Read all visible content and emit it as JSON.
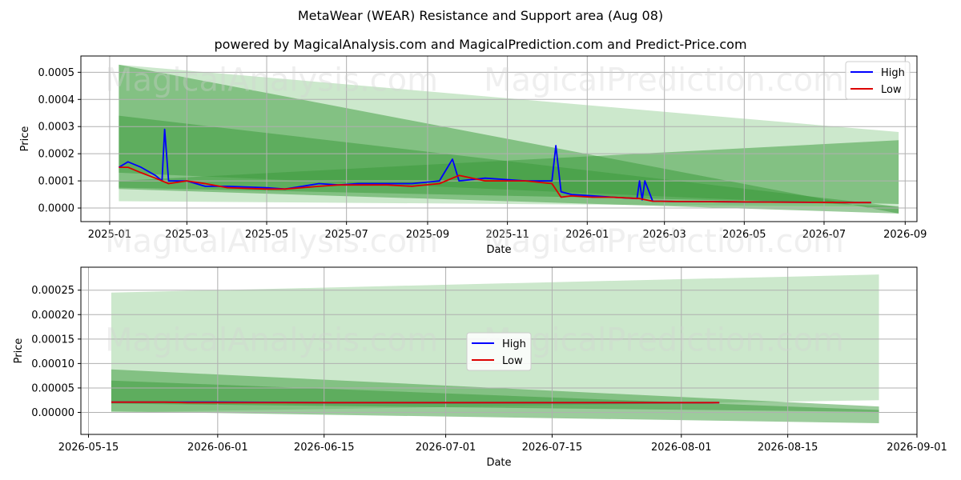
{
  "title": "MetaWear (WEAR) Resistance and Support area (Aug 08)",
  "subtitle": "powered by MagicalAnalysis.com and MagicalPrediction.com and Predict-Price.com",
  "watermark": [
    "MagicalAnalysis.com",
    "MagicalPrediction.com"
  ],
  "colors": {
    "high": "#0000ff",
    "low": "#dd0000",
    "band_dark": "#3a9a3a",
    "band_light": "#8fcc8f"
  },
  "chart_data": [
    {
      "type": "line",
      "xlabel": "Date",
      "ylabel": "Price",
      "x_ticks": [
        "2025-01",
        "2025-03",
        "2025-05",
        "2025-07",
        "2025-09",
        "2025-11",
        "2026-01",
        "2026-03",
        "2026-05",
        "2026-07",
        "2026-09"
      ],
      "y_ticks": [
        "0.0000",
        "0.0001",
        "0.0002",
        "0.0003",
        "0.0004",
        "0.0005"
      ],
      "xlim": [
        "2024-12-10",
        "2026-09-10"
      ],
      "ylim": [
        -5e-05,
        0.00056
      ],
      "grid": true,
      "legend": {
        "position": "top-right",
        "entries": [
          "High",
          "Low"
        ]
      },
      "series": [
        {
          "name": "High",
          "x": [
            "2025-01-08",
            "2025-01-15",
            "2025-01-25",
            "2025-02-05",
            "2025-02-10",
            "2025-02-12",
            "2025-02-15",
            "2025-03-01",
            "2025-03-15",
            "2025-04-01",
            "2025-05-01",
            "2025-05-15",
            "2025-06-10",
            "2025-06-25",
            "2025-07-10",
            "2025-08-01",
            "2025-08-20",
            "2025-09-10",
            "2025-09-20",
            "2025-09-25",
            "2025-10-15",
            "2025-11-15",
            "2025-12-05",
            "2025-12-08",
            "2025-12-12",
            "2025-12-20",
            "2026-01-05",
            "2026-01-20",
            "2026-02-08",
            "2026-02-10",
            "2026-02-12",
            "2026-02-14",
            "2026-02-20",
            "2026-03-10",
            "2026-04-15",
            "2026-05-20",
            "2026-06-20",
            "2026-07-20",
            "2026-08-06"
          ],
          "values": [
            0.00015,
            0.00017,
            0.00015,
            0.00012,
            0.0001,
            0.00029,
            0.0001,
            0.0001,
            8e-05,
            8e-05,
            7.5e-05,
            7e-05,
            9e-05,
            8.5e-05,
            9e-05,
            9e-05,
            9e-05,
            0.0001,
            0.00018,
            0.0001,
            0.00011,
            0.0001,
            0.0001,
            0.00023,
            6e-05,
            5e-05,
            4.5e-05,
            4e-05,
            3.5e-05,
            0.0001,
            3e-05,
            0.0001,
            2.5e-05,
            2.4e-05,
            2.3e-05,
            2.2e-05,
            2.1e-05,
            2e-05,
            2e-05
          ]
        },
        {
          "name": "Low",
          "x": [
            "2025-01-08",
            "2025-01-15",
            "2025-01-25",
            "2025-02-05",
            "2025-02-15",
            "2025-03-01",
            "2025-03-15",
            "2025-04-01",
            "2025-05-01",
            "2025-05-15",
            "2025-06-10",
            "2025-06-25",
            "2025-07-10",
            "2025-08-01",
            "2025-08-20",
            "2025-09-10",
            "2025-09-25",
            "2025-10-15",
            "2025-11-15",
            "2025-12-05",
            "2025-12-12",
            "2025-12-20",
            "2026-01-05",
            "2026-01-20",
            "2026-02-10",
            "2026-02-20",
            "2026-03-10",
            "2026-04-15",
            "2026-05-20",
            "2026-06-20",
            "2026-07-20",
            "2026-08-06"
          ],
          "values": [
            0.00015,
            0.00015,
            0.00013,
            0.00011,
            9e-05,
            0.0001,
            9e-05,
            7.5e-05,
            7e-05,
            7e-05,
            8e-05,
            8.5e-05,
            8.5e-05,
            8.5e-05,
            8e-05,
            9e-05,
            0.00012,
            0.0001,
            0.0001,
            9e-05,
            4e-05,
            4.5e-05,
            4e-05,
            4e-05,
            3.5e-05,
            2.5e-05,
            2.4e-05,
            2.3e-05,
            2.2e-05,
            2.1e-05,
            2e-05,
            2e-05
          ]
        }
      ],
      "bands": [
        {
          "shade": "light",
          "x": [
            "2025-01-08",
            "2026-08-27"
          ],
          "upper": [
            0.000528,
            0.00028
          ],
          "lower": [
            2.5e-05,
            5e-06
          ]
        },
        {
          "shade": "mid",
          "x": [
            "2025-01-08",
            "2026-08-27"
          ],
          "upper": [
            0.000528,
            -2e-05
          ],
          "lower": [
            0.00013,
            5e-06
          ]
        },
        {
          "shade": "dark",
          "x": [
            "2025-01-08",
            "2026-08-27"
          ],
          "upper": [
            0.00034,
            5e-06
          ],
          "lower": [
            7e-05,
            -2e-05
          ]
        },
        {
          "shade": "dark",
          "x": [
            "2025-01-08",
            "2026-08-27"
          ],
          "upper": [
            0.0001,
            0.00025
          ],
          "lower": [
            7.5e-05,
            1.5e-05
          ]
        }
      ]
    },
    {
      "type": "line",
      "xlabel": "Date",
      "ylabel": "Price",
      "x_ticks": [
        "2026-05-15",
        "2026-06-01",
        "2026-06-15",
        "2026-07-01",
        "2026-07-15",
        "2026-08-01",
        "2026-08-15",
        "2026-09-01"
      ],
      "y_ticks": [
        "0.00000",
        "0.00005",
        "0.00010",
        "0.00015",
        "0.00020",
        "0.00025"
      ],
      "xlim": [
        "2026-05-14",
        "2026-09-01"
      ],
      "ylim": [
        -4.5e-05,
        0.000297
      ],
      "grid": true,
      "legend": {
        "position": "center",
        "entries": [
          "High",
          "Low"
        ]
      },
      "series": [
        {
          "name": "High",
          "x": [
            "2026-05-18",
            "2026-05-25",
            "2026-06-01",
            "2026-06-15",
            "2026-07-01",
            "2026-07-15",
            "2026-08-01",
            "2026-08-06"
          ],
          "values": [
            2.1e-05,
            2.1e-05,
            2.1e-05,
            2e-05,
            2e-05,
            2e-05,
            2e-05,
            2e-05
          ]
        },
        {
          "name": "Low",
          "x": [
            "2026-05-18",
            "2026-05-25",
            "2026-05-28",
            "2026-06-01",
            "2026-06-15",
            "2026-07-01",
            "2026-07-15",
            "2026-08-01",
            "2026-08-06"
          ],
          "values": [
            2.1e-05,
            2.1e-05,
            2e-05,
            2e-05,
            2e-05,
            2e-05,
            2e-05,
            2e-05,
            2e-05
          ]
        }
      ],
      "bands": [
        {
          "shade": "light",
          "x": [
            "2026-05-18",
            "2026-08-27"
          ],
          "upper": [
            0.000245,
            0.000282
          ],
          "lower": [
            0.0,
            2.5e-05
          ]
        },
        {
          "shade": "mid",
          "x": [
            "2026-05-18",
            "2026-08-27"
          ],
          "upper": [
            8.8e-05,
            1.2e-05
          ],
          "lower": [
            2e-06,
            -2.2e-05
          ]
        },
        {
          "shade": "dark",
          "x": [
            "2026-05-18",
            "2026-08-27"
          ],
          "upper": [
            6.5e-05,
            5e-06
          ],
          "lower": [
            1.8e-05,
            1e-06
          ]
        }
      ]
    }
  ]
}
